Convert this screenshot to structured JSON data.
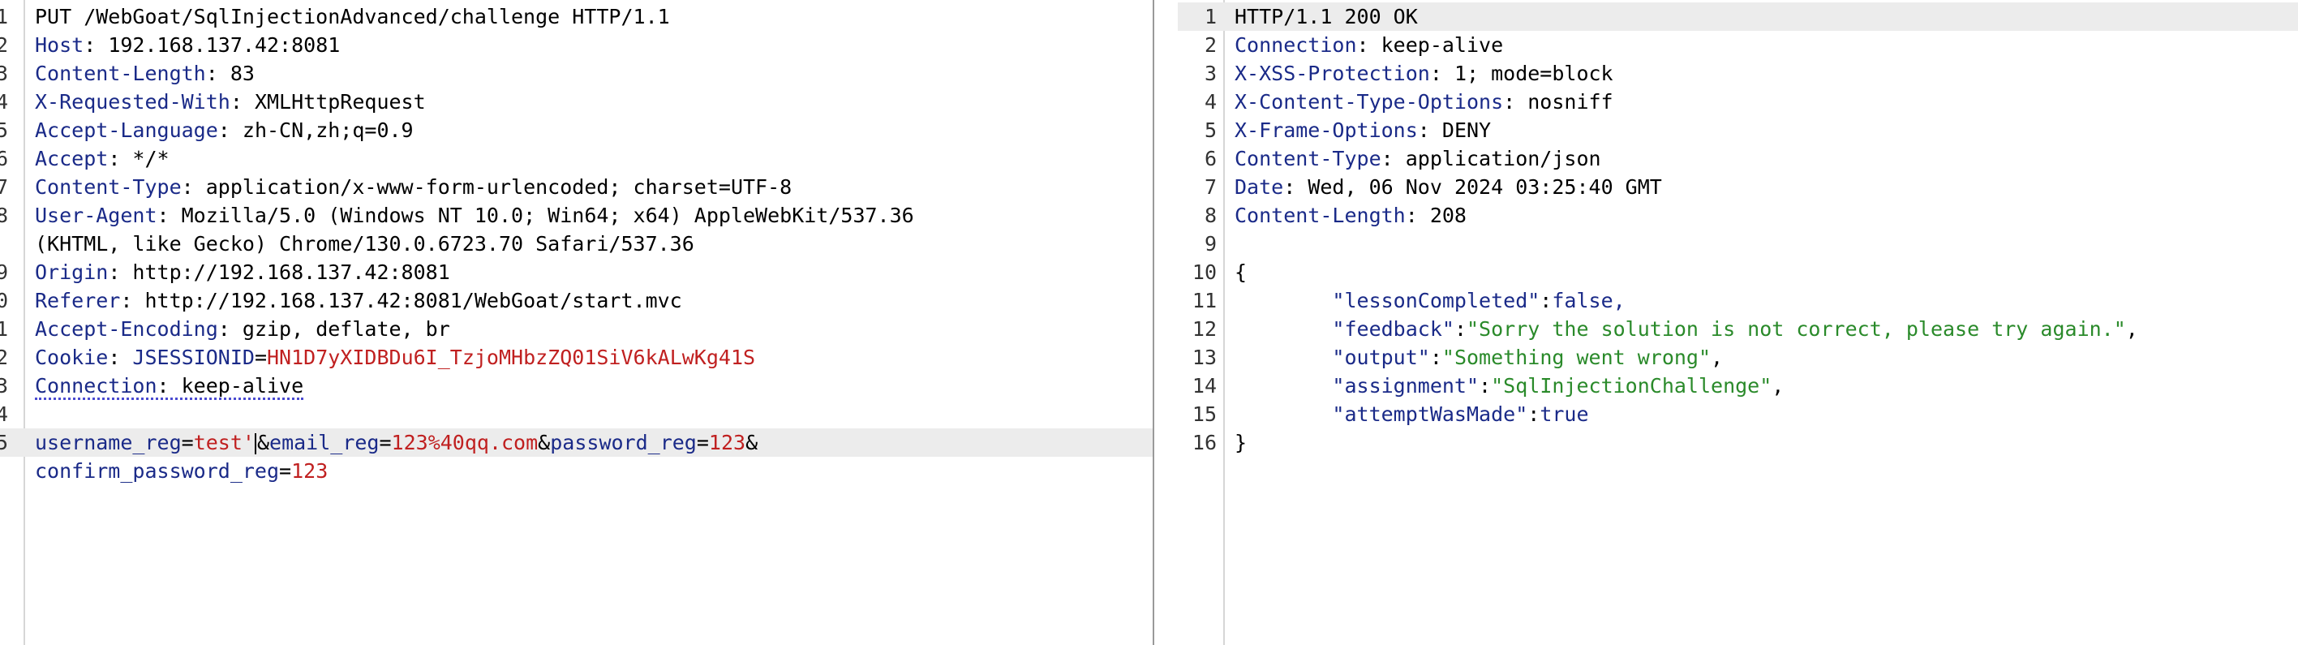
{
  "request": {
    "method_line": "PUT /WebGoat/SqlInjectionAdvanced/challenge HTTP/1.1",
    "headers": [
      {
        "ln": "2",
        "name": "Host",
        "value": " 192.168.137.42:8081"
      },
      {
        "ln": "3",
        "name": "Content-Length",
        "value": " 83"
      },
      {
        "ln": "4",
        "name": "X-Requested-With",
        "value": " XMLHttpRequest"
      },
      {
        "ln": "5",
        "name": "Accept-Language",
        "value": " zh-CN,zh;q=0.9"
      },
      {
        "ln": "6",
        "name": "Accept",
        "value": " */*"
      },
      {
        "ln": "7",
        "name": "Content-Type",
        "value": " application/x-www-form-urlencoded; charset=UTF-8"
      },
      {
        "ln": "8",
        "name": "User-Agent",
        "value": " Mozilla/5.0 (Windows NT 10.0; Win64; x64) AppleWebKit/537.36"
      },
      {
        "ln": "",
        "name": "",
        "value": "(KHTML, like Gecko) Chrome/130.0.6723.70 Safari/537.36"
      },
      {
        "ln": "9",
        "name": "Origin",
        "value": " http://192.168.137.42:8081"
      },
      {
        "ln": "0",
        "name": "Referer",
        "value": " http://192.168.137.42:8081/WebGoat/start.mvc"
      },
      {
        "ln": "1",
        "name": "Accept-Encoding",
        "value": " gzip, deflate, br"
      }
    ],
    "cookie": {
      "ln": "2",
      "name": "Cookie",
      "cookie_name": "JSESSIONID",
      "cookie_value": "HN1D7yXIDBDu6I_TzjoMHbzZQ01SiV6kALwKg41S"
    },
    "connection": {
      "ln": "3",
      "name": "Connection",
      "value": " keep-alive"
    },
    "blank_ln": "4",
    "body": {
      "ln": "5",
      "params": [
        {
          "name": "username_reg",
          "value": "test'"
        },
        {
          "name": "email_reg",
          "value": "123%40qq.com"
        },
        {
          "name": "password_reg",
          "value": "123"
        }
      ],
      "trailing": "&",
      "param2_name": "confirm_password_reg",
      "param2_value": "123"
    }
  },
  "response": {
    "lines": [
      {
        "ln": "1",
        "text": "HTTP/1.1 200 OK"
      },
      {
        "ln": "2",
        "name": "Connection",
        "value": " keep-alive"
      },
      {
        "ln": "3",
        "name": "X-XSS-Protection",
        "value": " 1; mode=block"
      },
      {
        "ln": "4",
        "name": "X-Content-Type-Options",
        "value": " nosniff"
      },
      {
        "ln": "5",
        "name": "X-Frame-Options",
        "value": " DENY"
      },
      {
        "ln": "6",
        "name": "Content-Type",
        "value": " application/json"
      },
      {
        "ln": "7",
        "name": "Date",
        "value": " Wed, 06 Nov 2024 03:25:40 GMT"
      },
      {
        "ln": "8",
        "name": "Content-Length",
        "value": " 208"
      },
      {
        "ln": "9",
        "text": ""
      },
      {
        "ln": "10",
        "text": "{"
      }
    ],
    "json": [
      {
        "ln": "11",
        "key": "\"lessonCompleted\"",
        "value": "false,",
        "string": false
      },
      {
        "ln": "12",
        "key": "\"feedback\"",
        "value": "\"Sorry the solution is not correct, please try again.\"",
        "string": true,
        "suffix": ","
      },
      {
        "ln": "13",
        "key": "\"output\"",
        "value": "\"Something went wrong\"",
        "string": true,
        "suffix": ","
      },
      {
        "ln": "14",
        "key": "\"assignment\"",
        "value": "\"SqlInjectionChallenge\"",
        "string": true,
        "suffix": ","
      },
      {
        "ln": "15",
        "key": "\"attemptWasMade\"",
        "value": "true",
        "string": false
      }
    ],
    "close": {
      "ln": "16",
      "text": "}"
    }
  }
}
